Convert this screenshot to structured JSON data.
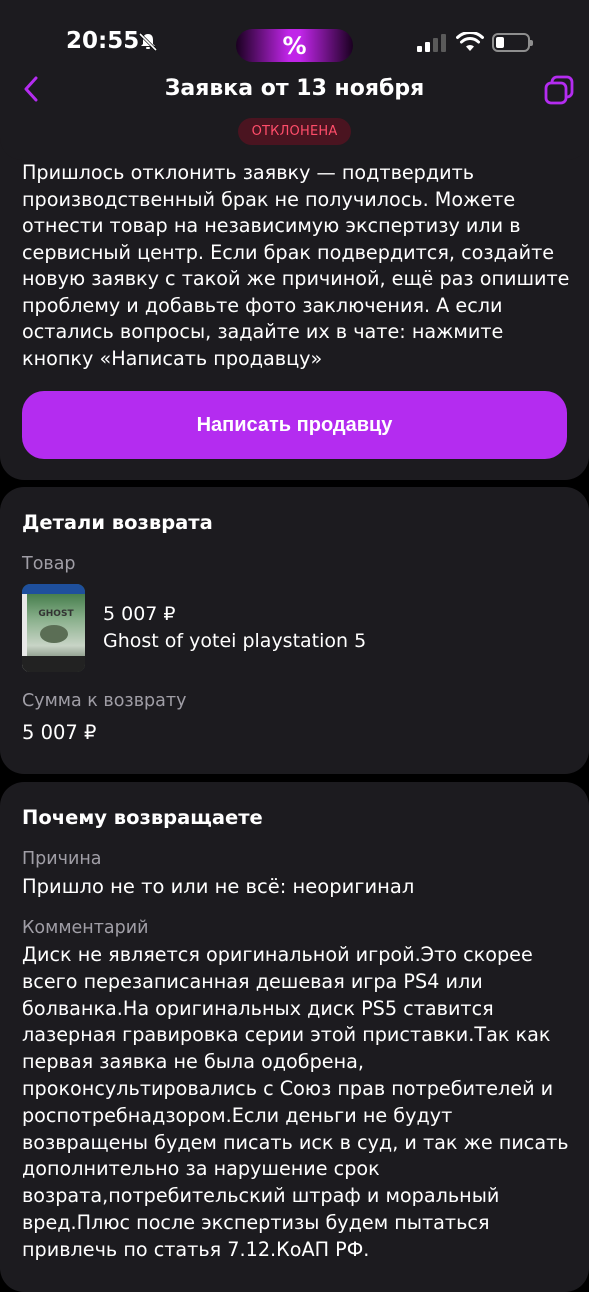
{
  "status_bar": {
    "time": "20:55",
    "island_glyph": "%"
  },
  "header": {
    "title": "Заявка от 13 ноября",
    "status": "ОТКЛОНЕНА"
  },
  "rejection": {
    "message": "Пришлось отклонить заявку — подтвердить производственный брак не получилось. Можете отнести товар на независимую экспертизу или в сервисный центр. Если брак подвердится, создайте новую заявку с такой же причиной, ещё раз опишите проблему и добавьте фото заключения. А если остались вопросы, задайте их в чате: нажмите кнопку «Написать продавцу»",
    "button": "Написать продавцу"
  },
  "details": {
    "title": "Детали возврата",
    "product_label": "Товар",
    "product_price": "5 007 ₽",
    "product_name": "Ghost of yotei playstation 5",
    "refund_label": "Сумма к возврату",
    "refund_value": "5 007 ₽",
    "product_image_text": "GHOST"
  },
  "reason": {
    "title": "Почему возвращаете",
    "reason_label": "Причина",
    "reason_value": "Пришло не то или не всё: неоригинал",
    "comment_label": "Комментарий",
    "comment_value": "Диск не является оригинальной игрой.Это скорее всего перезаписанная дешевая игра PS4 или болванка.На оригинальных диск PS5 ставится лазерная гравировка серии этой приставки.Так как первая заявка не была одобрена, проконсультировались с Союз прав потребителей и роспотребнадзором.Если деньги не будут возвращены будем писать иск в суд, и так же писать дополнительно за нарушение срок возрата,потребительский штраф и моральный вред.Плюс после экспертизы будем пытаться привлечь по статья 7.12.КоАП РФ."
  },
  "colors": {
    "accent": "#b42cf0",
    "card": "#1c1b1f",
    "reject_text": "#ff4d6a",
    "reject_bg": "#4a1420"
  }
}
